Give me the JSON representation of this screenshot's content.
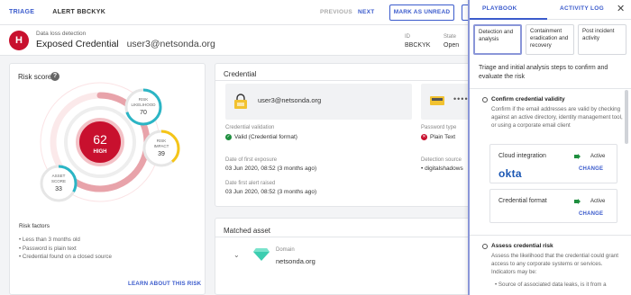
{
  "topbar": {
    "breadcrumb_triage": "TRIAGE",
    "breadcrumb_alert": "ALERT BBCKYK",
    "previous": "PREVIOUS",
    "next": "NEXT",
    "mark_unread": "MARK AS UNREAD"
  },
  "header": {
    "icon_letter": "H",
    "subtitle": "Data loss detection",
    "title": "Exposed Credential",
    "email": "user3@netsonda.org",
    "id_label": "ID",
    "id_value": "BBCKYK",
    "state_label": "State",
    "state_value": "Open"
  },
  "risk": {
    "title": "Risk score",
    "score": "62",
    "level": "HIGH",
    "likelihood_label_1": "RISK",
    "likelihood_label_2": "LIKELIHOOD",
    "likelihood_value": "70",
    "likelihood_fraction": 0.7,
    "impact_label_1": "RISK",
    "impact_label_2": "IMPACT",
    "impact_value": "39",
    "impact_fraction": 0.39,
    "asset_label_1": "ASSET",
    "asset_label_2": "SCORE",
    "asset_value": "33",
    "asset_fraction": 0.33,
    "score_fraction": 0.62,
    "factors_title": "Risk factors",
    "factors": [
      "Less than 3 months old",
      "Password is plain text",
      "Credential found on a closed source"
    ],
    "learn_more": "LEARN ABOUT THIS RISK",
    "colors": {
      "high": "#c8102e",
      "likelihood": "#2bb5c5",
      "impact": "#f5c518",
      "asset": "#2bb5c5"
    }
  },
  "credential": {
    "title": "Credential",
    "email": "user3@netsonda.org",
    "password_mask": "••••",
    "validation_label": "Credential validation",
    "validation_value": "Valid (Credential format)",
    "password_type_label": "Password type",
    "password_type_value": "Plain Text",
    "first_exposure_label": "Date of first exposure",
    "first_exposure_value": "03 Jun 2020, 08:52 (3 months ago)",
    "detection_label": "Detection source",
    "detection_value": "digitalshadows",
    "first_alert_label": "Date first alert raised",
    "first_alert_value": "03 Jun 2020, 08:52 (3 months ago)"
  },
  "asset": {
    "title": "Matched asset",
    "domain_label": "Domain",
    "domain_value": "netsonda.org"
  },
  "panel": {
    "tab_playbook": "PLAYBOOK",
    "tab_activity": "ACTIVITY LOG",
    "phase1": "Detection and analysis",
    "phase2": "Containment eradication and recovery",
    "phase3": "Post incident activity",
    "intro": "Triage and initial analysis steps to confirm and evaluate the risk",
    "step1_title": "Confirm credential validity",
    "step1_body": "Confirm if the email addresses are valid by checking against an active directory, identity management tool, or using a corporate email client",
    "int1_name": "Cloud integration",
    "int1_logo": "okta",
    "int1_status": "Active",
    "int1_change": "CHANGE",
    "int2_name": "Credential format",
    "int2_status": "Active",
    "int2_change": "CHANGE",
    "step2_title": "Assess credential risk",
    "step2_body": "Assess the likelihood that the credential could grant access to any corporate systems or services. Indicators may be:",
    "step2_bullet": "Source of associated data leaks, is it from a"
  }
}
